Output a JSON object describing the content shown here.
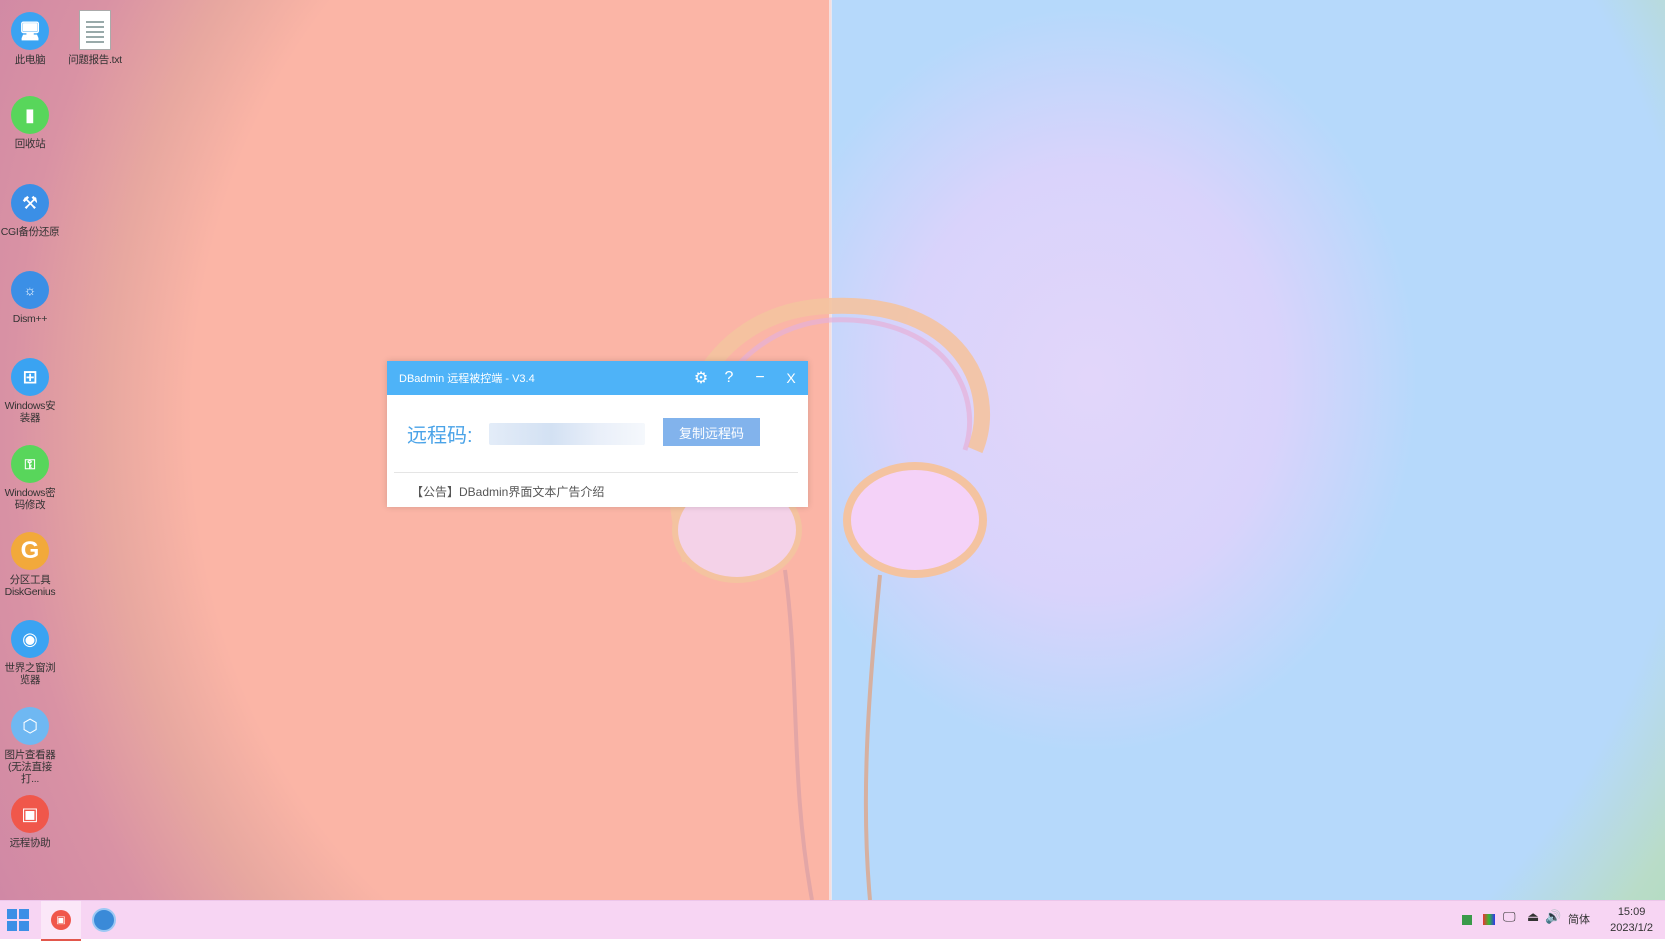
{
  "desktop": {
    "icons": [
      {
        "label": "此电脑",
        "icon": "computer-icon",
        "color": "#3aa3f2",
        "glyph": "🖥"
      },
      {
        "label": "问题报告.txt",
        "icon": "text-file-icon",
        "color": "#ffffff",
        "glyph": ""
      },
      {
        "label": "回收站",
        "icon": "recycle-bin-icon",
        "color": "#58d65b",
        "glyph": "🗑"
      },
      {
        "label": "CGI备份还原",
        "icon": "tools-icon",
        "color": "#3b8fe6",
        "glyph": "⚒"
      },
      {
        "label": "Dism++",
        "icon": "gear-icon",
        "color": "#3b8fe6",
        "glyph": "⚙"
      },
      {
        "label": "Windows安装器",
        "icon": "windows-icon",
        "color": "#3aa3f2",
        "glyph": "⊞"
      },
      {
        "label": "Windows密码修改",
        "icon": "key-icon",
        "color": "#58d65b",
        "glyph": "🔑"
      },
      {
        "label": "分区工具DiskGenius",
        "icon": "diskgenius-icon",
        "color": "#f2a93b",
        "glyph": "G"
      },
      {
        "label": "世界之窗浏览器",
        "icon": "browser-icon",
        "color": "#3aa3f2",
        "glyph": "🌐"
      },
      {
        "label": "图片查看器(无法直接打...",
        "icon": "image-viewer-icon",
        "color": "#6fb8f2",
        "glyph": "⬡"
      },
      {
        "label": "远程协助",
        "icon": "remote-assist-icon",
        "color": "#f0574b",
        "glyph": "▣"
      }
    ]
  },
  "dialog": {
    "title": "DBadmin 远程被控端 - V3.4",
    "code_label": "远程码:",
    "copy_button": "复制远程码",
    "notice": "【公告】DBadmin界面文本广告介绍",
    "settings_glyph": "⚙",
    "help_glyph": "?",
    "minimize_glyph": "−",
    "close_glyph": "X"
  },
  "taskbar": {
    "start_icon": "windows-start-icon",
    "apps": [
      {
        "icon": "remote-assist-icon",
        "active": true
      },
      {
        "icon": "browser-icon",
        "active": false
      }
    ],
    "ime_label": "简体",
    "clock_time": "15:09",
    "clock_date": "2023/1/2"
  },
  "colors": {
    "title_bar": "#4eb3f8",
    "copy_button": "#82b3ec",
    "code_label": "#4aa3e8"
  }
}
